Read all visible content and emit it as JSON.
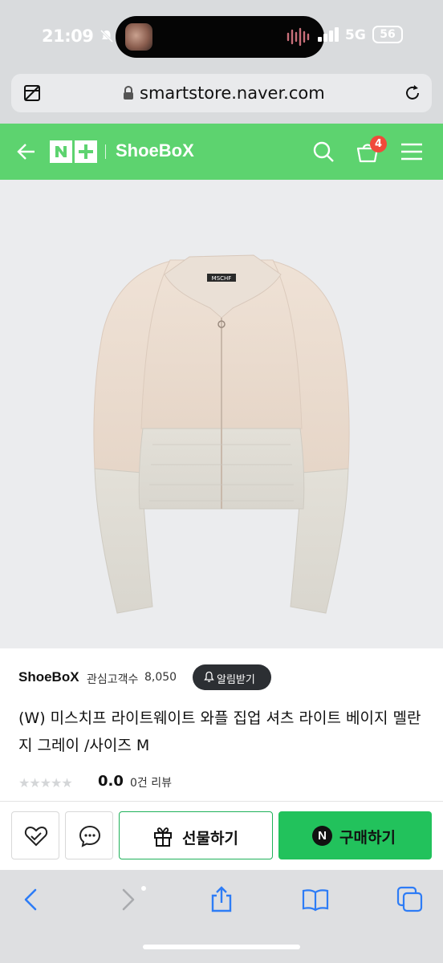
{
  "status_bar": {
    "time": "21:09",
    "network": "5G",
    "battery": "56"
  },
  "browser": {
    "url": "smartstore.naver.com"
  },
  "header": {
    "logo_text": "N+",
    "store_name": "ShoeBoX",
    "cart_count": "4",
    "accent_color": "#5dd36f"
  },
  "product": {
    "image_label": "MSCHF",
    "seller": "ShoeBoX",
    "interest_label": "관심고객수",
    "interest_count": "8,050",
    "notify_label": "알림받기",
    "title": "(W) 미스치프 라이트웨이트 와플 집업 셔츠 라이트 베이지 멜란지 그레이 /사이즈 M",
    "rating_stars": "★★★★★",
    "rating": "0.0",
    "reviews": "0건 리뷰"
  },
  "actions": {
    "gift_label": "선물하기",
    "buy_label": "구매하기",
    "npay_badge": "N",
    "buy_color": "#22c25c"
  }
}
